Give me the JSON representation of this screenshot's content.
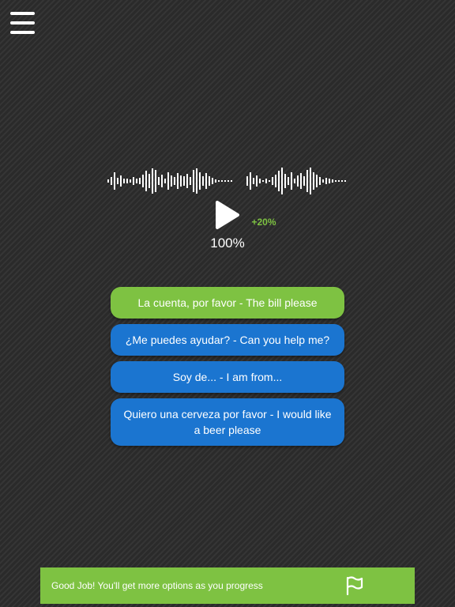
{
  "icons": {
    "menu": "hamburger-menu-icon",
    "play": "play-icon",
    "flag": "flag-icon",
    "waveform": "audio-waveform"
  },
  "colors": {
    "background": "#2c2c2c",
    "accent_green": "#7ec242",
    "option_blue": "#1b75d0",
    "text": "#ffffff"
  },
  "player": {
    "speed_label": "+20%",
    "volume_label": "100%"
  },
  "options": [
    {
      "label": "La cuenta, por favor - The bill please",
      "state": "correct"
    },
    {
      "label": "¿Me puedes ayudar? - Can you help me?",
      "state": "default"
    },
    {
      "label": "Soy de... - I am from...",
      "state": "default"
    },
    {
      "label": "Quiero una cerveza por favor - I would like a beer please",
      "state": "default"
    }
  ],
  "footer": {
    "message": "Good Job! You'll get more options as you progress"
  }
}
